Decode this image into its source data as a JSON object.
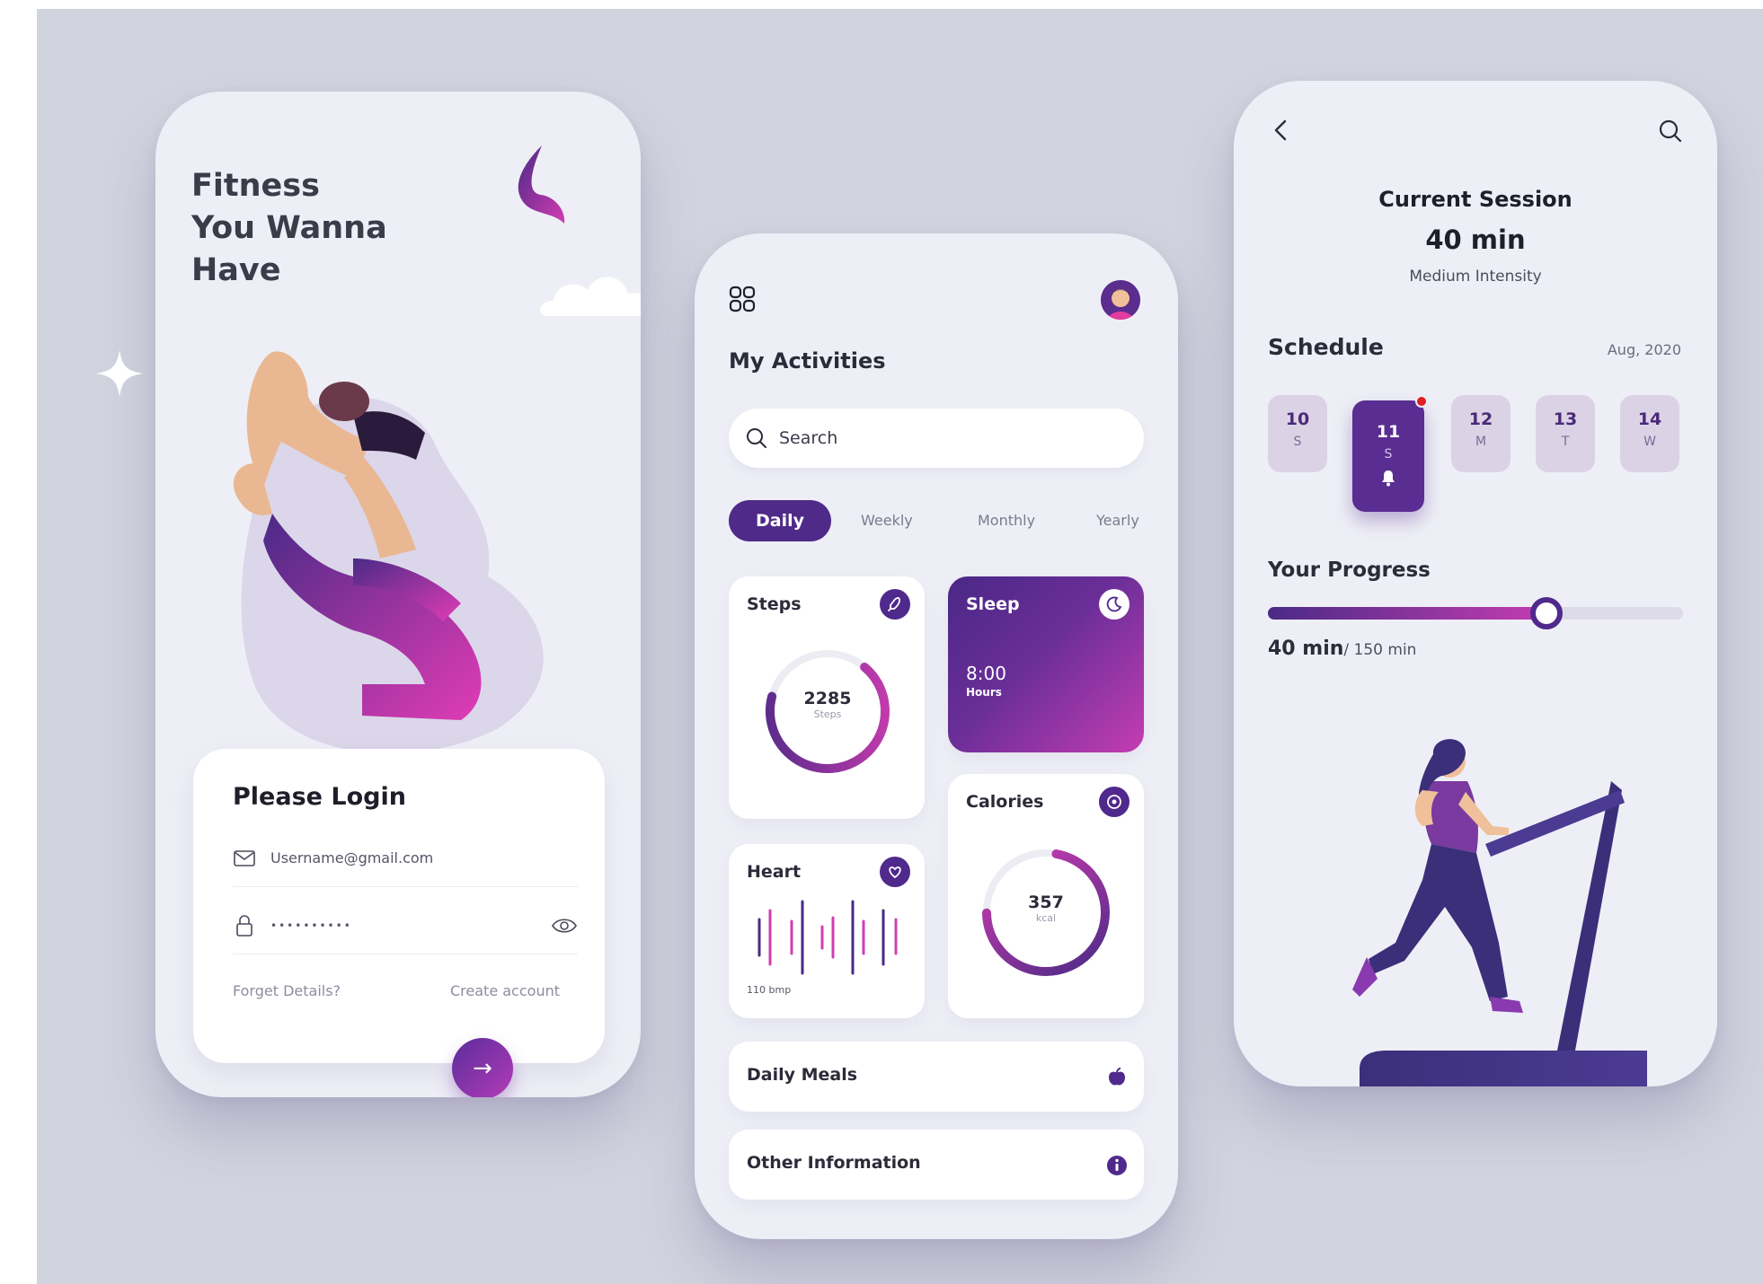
{
  "colors": {
    "background": "#d1d3de",
    "phone": "#eeeff6",
    "primary": "#50298c",
    "accent": "#c43db2",
    "notification_dot": "#e01f26"
  },
  "login_screen": {
    "headline": [
      "Fitness",
      "You Wanna",
      "Have"
    ],
    "login_title": "Please Login",
    "email_value": "Username@gmail.com",
    "password_value": "••••••••••",
    "forgot_label": "Forget Details?",
    "create_label": "Create account",
    "submit_glyph": "→",
    "icons": [
      "logo-icon",
      "cloud-icon",
      "sparkle-icon",
      "mail-icon",
      "lock-icon",
      "eye-icon",
      "arrow-right-icon"
    ]
  },
  "activities_screen": {
    "title": "My Activities",
    "search_placeholder": "Search",
    "tabs": [
      {
        "label": "Daily",
        "active": true
      },
      {
        "label": "Weekly",
        "active": false
      },
      {
        "label": "Monthly",
        "active": false
      },
      {
        "label": "Yearly",
        "active": false
      }
    ],
    "steps": {
      "title": "Steps",
      "value": "2285",
      "unit": "Steps",
      "progress": 0.68
    },
    "sleep": {
      "title": "Sleep",
      "value": "8:00",
      "unit": "Hours"
    },
    "calories": {
      "title": "Calories",
      "value": "357",
      "unit": "kcal",
      "progress": 0.72
    },
    "heart": {
      "title": "Heart",
      "value": "110 bmp"
    },
    "rows": [
      {
        "label": "Daily Meals",
        "icon": "apple-icon"
      },
      {
        "label": "Other Information",
        "icon": "info-icon"
      }
    ],
    "icons": [
      "grid-icon",
      "avatar",
      "search-icon",
      "rocket-icon",
      "moon-icon",
      "target-icon",
      "heart-icon"
    ]
  },
  "session_screen": {
    "title": "Current Session",
    "duration": "40 min",
    "intensity": "Medium Intensity",
    "schedule_title": "Schedule",
    "schedule_date": "Aug, 2020",
    "days": [
      {
        "num": "10",
        "weekday": "S",
        "active": false
      },
      {
        "num": "11",
        "weekday": "S",
        "active": true
      },
      {
        "num": "12",
        "weekday": "M",
        "active": false
      },
      {
        "num": "13",
        "weekday": "T",
        "active": false
      },
      {
        "num": "14",
        "weekday": "W",
        "active": false
      }
    ],
    "progress_title": "Your Progress",
    "progress_current": "40 min",
    "progress_total": "/ 150 min",
    "progress_fraction": 0.67,
    "icons": [
      "back-icon",
      "search-icon",
      "bell-icon",
      "notification-dot"
    ]
  }
}
